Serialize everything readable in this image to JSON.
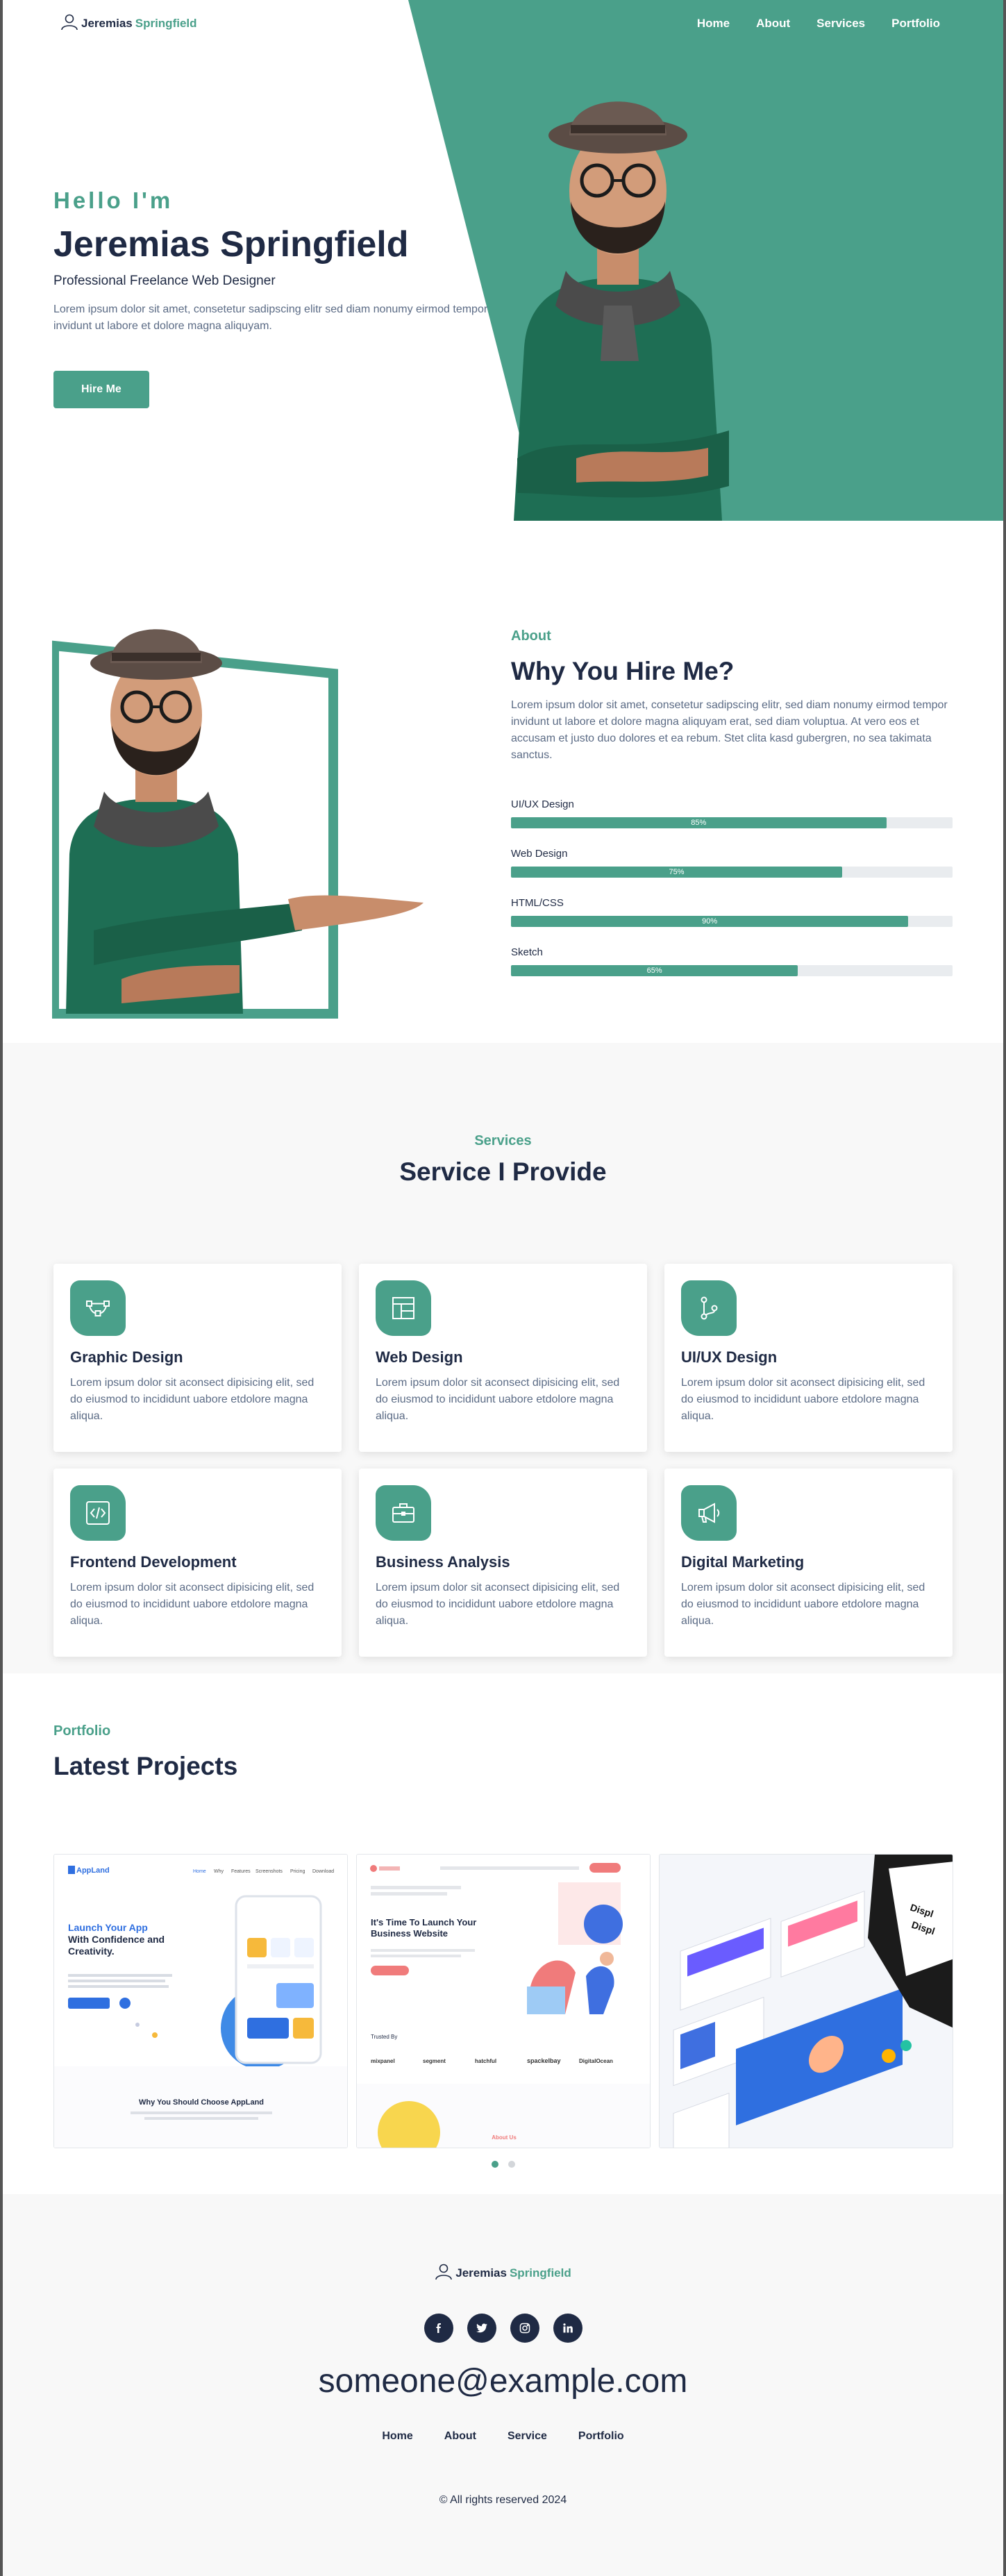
{
  "brand": {
    "first": "Jeremias",
    "last": "Springfield",
    "accent": "#4aa08a",
    "dark": "#1f2a44"
  },
  "nav": {
    "items": [
      "Home",
      "About",
      "Services",
      "Portfolio"
    ]
  },
  "hero": {
    "greeting": "Hello I'm",
    "name": "Jeremias Springfield",
    "role": "Professional Freelance Web Designer",
    "intro": "Lorem ipsum dolor sit amet, consetetur sadipscing elitr sed diam nonumy eirmod tempor invidunt ut labore et dolore magna aliquyam.",
    "cta": "Hire Me"
  },
  "about": {
    "eyebrow": "About",
    "title": "Why You Hire Me?",
    "description": "Lorem ipsum dolor sit amet, consetetur sadipscing elitr, sed diam nonumy eirmod tempor invidunt ut labore et dolore magna aliquyam erat, sed diam voluptua. At vero eos et accusam et justo duo dolores et ea rebum. Stet clita kasd gubergren, no sea takimata sanctus.",
    "skills": [
      {
        "name": "UI/UX Design",
        "percent": 85,
        "label": "85%"
      },
      {
        "name": "Web Design",
        "percent": 75,
        "label": "75%"
      },
      {
        "name": "HTML/CSS",
        "percent": 90,
        "label": "90%"
      },
      {
        "name": "Sketch",
        "percent": 65,
        "label": "65%"
      }
    ]
  },
  "services": {
    "eyebrow": "Services",
    "title": "Service I Provide",
    "items": [
      {
        "icon": "vector-pen-icon",
        "title": "Graphic Design",
        "desc": "Lorem ipsum dolor sit aconsect dipisicing elit, sed do eiusmod to incididunt uabore etdolore magna aliqua."
      },
      {
        "icon": "layout-icon",
        "title": "Web Design",
        "desc": "Lorem ipsum dolor sit aconsect dipisicing elit, sed do eiusmod to incididunt uabore etdolore magna aliqua."
      },
      {
        "icon": "git-branch-icon",
        "title": "UI/UX Design",
        "desc": "Lorem ipsum dolor sit aconsect dipisicing elit, sed do eiusmod to incididunt uabore etdolore magna aliqua."
      },
      {
        "icon": "code-icon",
        "title": "Frontend Development",
        "desc": "Lorem ipsum dolor sit aconsect dipisicing elit, sed do eiusmod to incididunt uabore etdolore magna aliqua."
      },
      {
        "icon": "briefcase-icon",
        "title": "Business Analysis",
        "desc": "Lorem ipsum dolor sit aconsect dipisicing elit, sed do eiusmod to incididunt uabore etdolore magna aliqua."
      },
      {
        "icon": "megaphone-icon",
        "title": "Digital Marketing",
        "desc": "Lorem ipsum dolor sit aconsect dipisicing elit, sed do eiusmod to incididunt uabore etdolore magna aliqua."
      }
    ]
  },
  "portfolio": {
    "eyebrow": "Portfolio",
    "title": "Latest Projects",
    "slide1": {
      "logo": "AppLand",
      "nav": [
        "Home",
        "Why",
        "Features",
        "Screenshots",
        "Pricing",
        "Download"
      ],
      "headline_a": "Launch Your App",
      "headline_b": "With Confidence and Creativity.",
      "bottom": "Why You Should Choose AppLand"
    },
    "slide2": {
      "headline": "It's Time To Launch Your Business Website",
      "trusted": "Trusted By",
      "logos": [
        "mixpanel",
        "segment",
        "hatchful",
        "spackelbay",
        "DigitalOcean"
      ],
      "footer": "About Us"
    },
    "dots": 2,
    "active_dot": 0
  },
  "footer": {
    "email": "someone@example.com",
    "socials": [
      "facebook-icon",
      "twitter-icon",
      "instagram-icon",
      "linkedin-icon"
    ],
    "menu": [
      "Home",
      "About",
      "Service",
      "Portfolio"
    ],
    "copyright": "© All rights reserved 2024"
  }
}
